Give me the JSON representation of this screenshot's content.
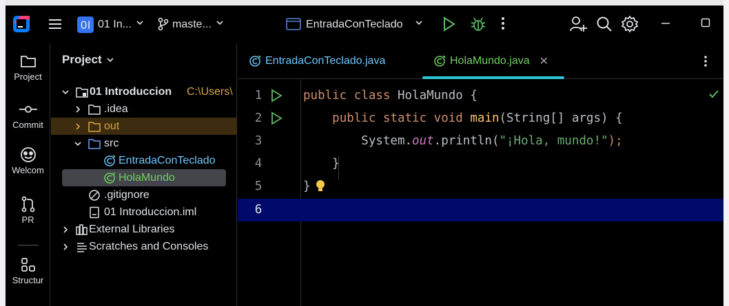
{
  "titlebar": {
    "project_badge": "0I",
    "project_name": "01 In...",
    "branch": "maste...",
    "run_config": "EntradaConTeclado"
  },
  "toolstrip": {
    "project": "Project",
    "commit": "Commit",
    "welcome": "Welcom",
    "pr": "PR",
    "structure": "Structur"
  },
  "project_panel": {
    "title": "Project",
    "tree": [
      {
        "label": "01 Introduccion",
        "path": "C:\\Users\\"
      },
      {
        "label": ".idea"
      },
      {
        "label": "out"
      },
      {
        "label": "src"
      },
      {
        "label": "EntradaConTeclado"
      },
      {
        "label": "HolaMundo"
      },
      {
        "label": ".gitignore"
      },
      {
        "label": "01 Introduccion.iml"
      },
      {
        "label": "External Libraries"
      },
      {
        "label": "Scratches and Consoles"
      }
    ]
  },
  "editor": {
    "tabs": [
      {
        "label": "EntradaConTeclado.java"
      },
      {
        "label": "HolaMundo.java"
      }
    ],
    "lines": [
      {
        "num": "1",
        "parts": [
          "public class ",
          "HolaMundo",
          " {"
        ]
      },
      {
        "num": "2",
        "parts": [
          "    ",
          "public static void ",
          "main",
          "(String[] args) {"
        ]
      },
      {
        "num": "3",
        "parts": [
          "        System.",
          "out",
          ".println(",
          "\"¡Hola, mundo!\"",
          ");"
        ]
      },
      {
        "num": "4",
        "parts": [
          "    }"
        ]
      },
      {
        "num": "5",
        "parts": [
          "}"
        ]
      },
      {
        "num": "6",
        "parts": [
          ""
        ]
      }
    ]
  },
  "colors": {
    "keyword": "#cf8e6d",
    "method": "#ffc66d",
    "string": "#6aab73",
    "static_field": "#c77dbb",
    "current_line": "#000a6a",
    "tab_accent": "#2ec8d7"
  }
}
